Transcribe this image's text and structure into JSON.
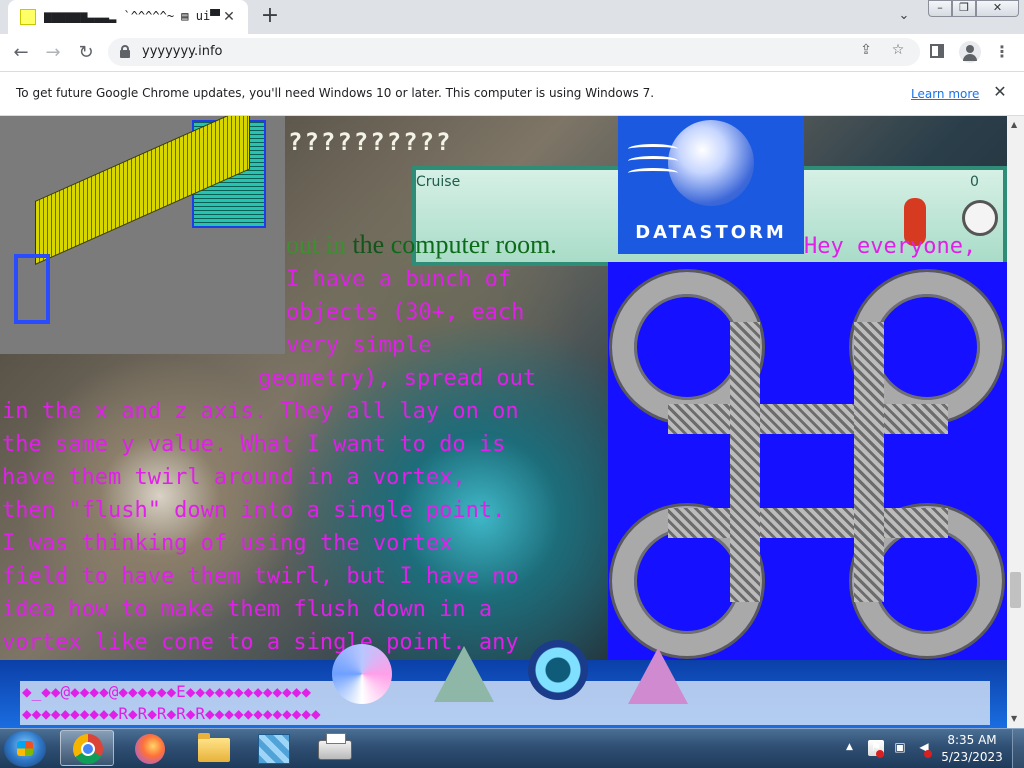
{
  "browser": {
    "tab": {
      "title": "▆▆▆▆▆▆▃▃▃▂ `^^^^^~ ▤ ui▀▀▀"
    },
    "address": {
      "url": "yyyyyyy.info"
    },
    "infobar": {
      "message": "To get future Google Chrome updates, you'll need Windows 10 or later. This computer is using Windows 7.",
      "link": "Learn more"
    }
  },
  "page": {
    "question_marks": "??????????",
    "cruise_label": "Cruise",
    "gauge_value": "0",
    "datastorm": "DATASTORM",
    "computer_room": {
      "w1": "out in ",
      "w2": "the ",
      "w3": "computer room."
    },
    "post_lines": [
      "Hey everyone,",
      "I have a bunch of",
      "objects (30+, each",
      "very simple",
      "geometry), spread out",
      "in the x and z axis. They all lay on on",
      "the same y value. What I want to do is",
      "have them twirl around in a vortex,",
      "then \"flush\" down into a single point.",
      "I was thinking of using the vortex",
      "field to have them twirl, but I have no",
      "idea how to make them flush down in a",
      "vortex like cone to a single point. any"
    ],
    "glyph_rows": [
      "◆_◆◆@◆◆◆◆@◆◆◆◆◆◆E◆◆◆◆◆◆◆◆◆◆◆◆◆",
      "◆◆◆◆◆◆◆◆◆◆R◆R◆R◆R◆R◆◆◆◆◆◆◆◆◆◆◆◆"
    ]
  },
  "taskbar": {
    "time": "8:35 AM",
    "date": "5/23/2023",
    "apps": [
      "Google Chrome",
      "Firefox",
      "Windows Explorer",
      "Application",
      "Printer"
    ]
  },
  "colors": {
    "post_text": "#e020e8",
    "tabstrip": "#dee1e6",
    "knot_bg": "#1510ff",
    "link": "#1a73e8"
  }
}
